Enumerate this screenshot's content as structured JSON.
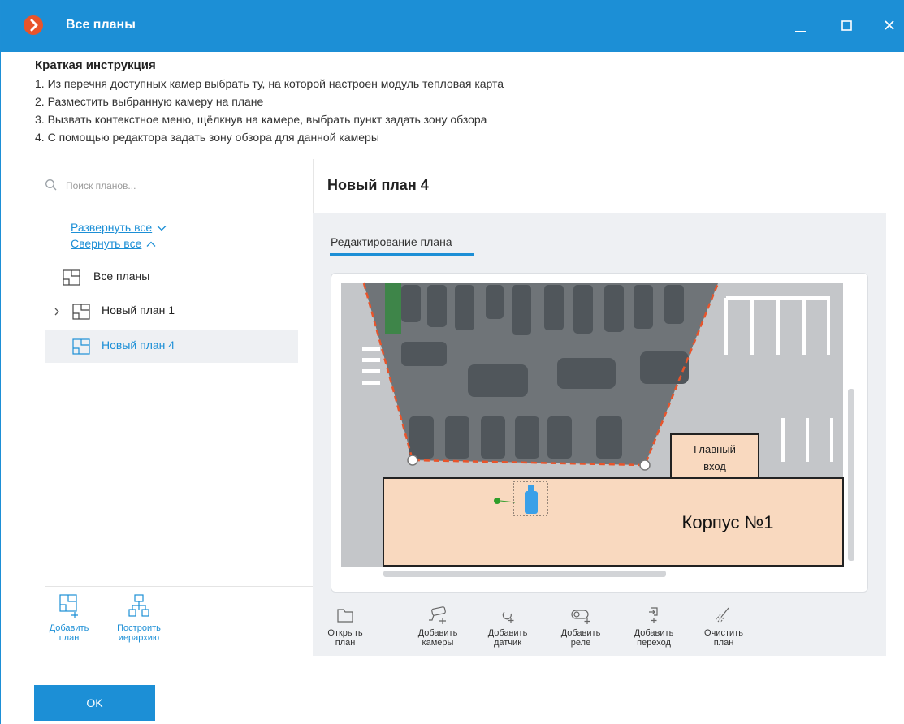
{
  "window": {
    "title": "Все планы",
    "accent_color": "#1c8fd6",
    "app_icon_color": "#e8542b",
    "controls": [
      "minimize-icon",
      "maximize-icon",
      "close-icon"
    ]
  },
  "instructions": {
    "title": "Краткая инструкция",
    "lines": [
      "1. Из перечня доступных камер выбрать ту, на которой настроен модуль тепловая карта",
      "2. Разместить выбранную камеру на плане",
      "3. Вызвать контекстное меню, щёлкнув на камере, выбрать пункт задать зону обзора",
      "4. С помощью редактора задать зону обзора для данной камеры"
    ]
  },
  "sidebar": {
    "search_placeholder": "Поиск планов...",
    "expand_all": "Развернуть все",
    "collapse_all": "Свернуть все",
    "items": [
      {
        "label": "Все планы",
        "icon": "plan-icon"
      },
      {
        "label": "Новый план 1",
        "icon": "plan-icon",
        "expandable": true
      },
      {
        "label": "Новый план 4",
        "icon": "plan-icon",
        "selected": true
      }
    ],
    "tools": [
      {
        "label_1": "Добавить",
        "label_2": "план",
        "icon": "add-plan-icon"
      },
      {
        "label_1": "Построить",
        "label_2": "иерархию",
        "icon": "hierarchy-icon"
      }
    ]
  },
  "main": {
    "plan_title": "Новый план 4",
    "tab": "Редактирование плана",
    "canvas": {
      "entrance_label_1": "Главный",
      "entrance_label_2": "вход",
      "building_label": "Корпус №1",
      "building_color": "#f9d9bf",
      "view_zone_color": "#e8542b",
      "camera_icon": "camera-icon"
    },
    "toolbar": [
      {
        "label_1": "Открыть",
        "label_2": "план",
        "icon": "folder-icon"
      },
      {
        "label_1": "Добавить",
        "label_2": "камеры",
        "icon": "add-camera-icon"
      },
      {
        "label_1": "Добавить",
        "label_2": "датчик",
        "icon": "add-sensor-icon"
      },
      {
        "label_1": "Добавить",
        "label_2": "реле",
        "icon": "add-relay-icon"
      },
      {
        "label_1": "Добавить",
        "label_2": "переход",
        "icon": "add-transition-icon"
      },
      {
        "label_1": "Очистить",
        "label_2": "план",
        "icon": "clear-plan-icon"
      }
    ]
  },
  "footer": {
    "ok_label": "OK"
  }
}
